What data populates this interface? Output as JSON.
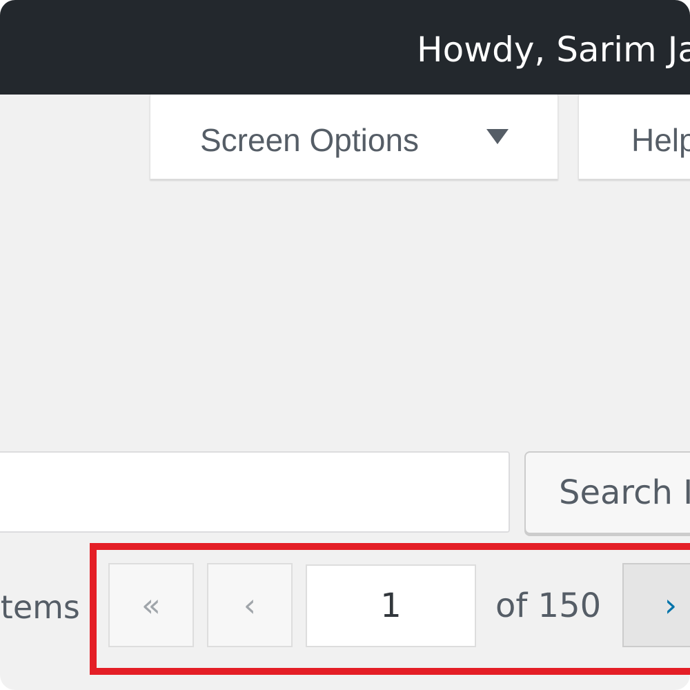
{
  "admin_bar": {
    "greeting": "Howdy, Sarim Ja"
  },
  "tabs": {
    "screen_options": {
      "label": "Screen Options",
      "icon": "caret-down-icon"
    },
    "help": {
      "label": "Help"
    }
  },
  "search": {
    "value": "",
    "button_label": "Search I"
  },
  "pagination": {
    "items_label": "items",
    "first_symbol": "«",
    "prev_symbol": "‹",
    "current_page": "1",
    "of_label": "of 150",
    "next_symbol": "›"
  },
  "colors": {
    "admin_bar": "#23282d",
    "page_background": "#f1f1f1",
    "highlight": "#e41e26",
    "link_blue": "#0073aa"
  }
}
